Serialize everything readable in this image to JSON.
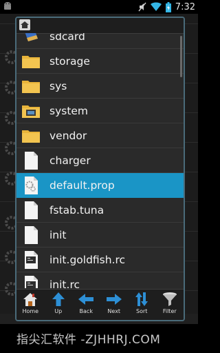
{
  "status_bar": {
    "time": "7:32",
    "icons": [
      "android-icon",
      "mute-icon",
      "wifi-icon",
      "battery-icon"
    ]
  },
  "dialog": {
    "header_icon": "home-icon",
    "items": [
      {
        "name": "sdcard",
        "icon": "sdcard-icon",
        "selected": false
      },
      {
        "name": "storage",
        "icon": "folder-icon",
        "selected": false
      },
      {
        "name": "sys",
        "icon": "folder-icon",
        "selected": false
      },
      {
        "name": "system",
        "icon": "system-folder-icon",
        "selected": false
      },
      {
        "name": "vendor",
        "icon": "folder-icon",
        "selected": false
      },
      {
        "name": "charger",
        "icon": "file-icon",
        "selected": false
      },
      {
        "name": "default.prop",
        "icon": "config-file-icon",
        "selected": true
      },
      {
        "name": "fstab.tuna",
        "icon": "file-icon",
        "selected": false
      },
      {
        "name": "init",
        "icon": "file-icon",
        "selected": false
      },
      {
        "name": "init.goldfish.rc",
        "icon": "script-file-icon",
        "selected": false
      },
      {
        "name": "init.rc",
        "icon": "script-file-icon",
        "selected": false
      }
    ],
    "toolbar": [
      {
        "label": "Home",
        "icon": "home-icon"
      },
      {
        "label": "Up",
        "icon": "arrow-up-icon"
      },
      {
        "label": "Back",
        "icon": "arrow-left-icon"
      },
      {
        "label": "Next",
        "icon": "arrow-right-icon"
      },
      {
        "label": "Sort",
        "icon": "sort-icon"
      },
      {
        "label": "Filter",
        "icon": "filter-icon"
      }
    ]
  },
  "watermark": "指尖汇软件 -ZJHHRJ.COM",
  "colors": {
    "selected": "#1a95c6",
    "folder": "#e8b43a",
    "toolbar_icon": "#2d8fd5",
    "dialog_border": "#4a6b7a"
  }
}
